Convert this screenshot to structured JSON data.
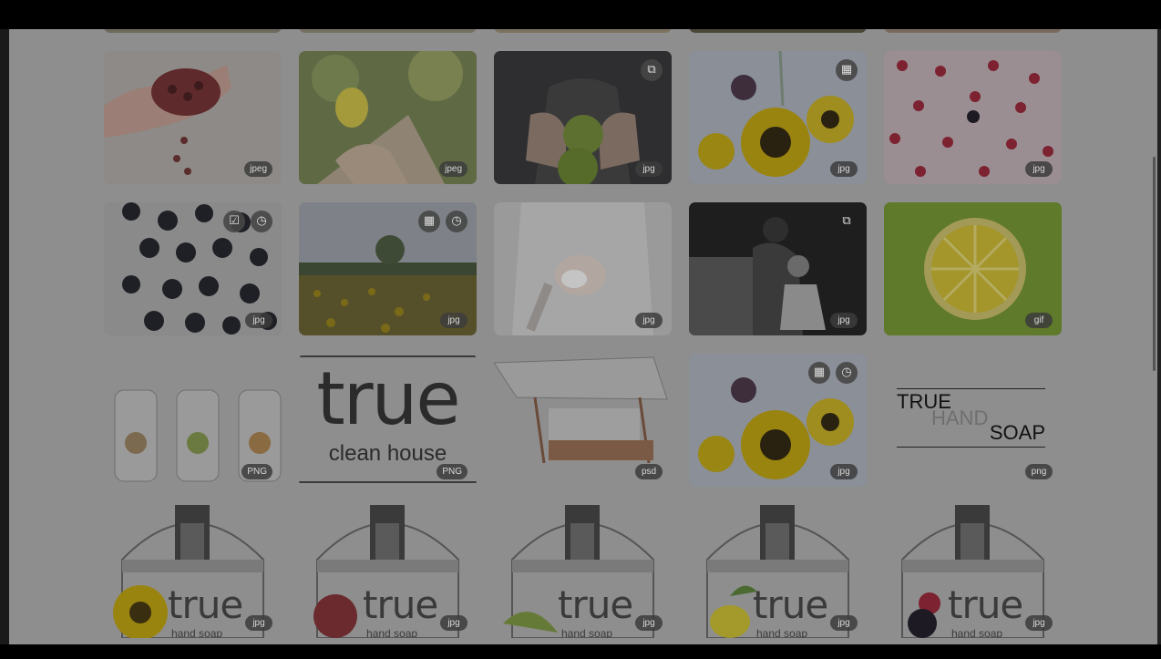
{
  "colors": {
    "overlay": "#8e8e8e",
    "frame": "#000000",
    "badge_bg": "#3c3c3c",
    "badge_text": "#d8d8d8"
  },
  "row0": [
    {
      "name": "partial-tile-1"
    },
    {
      "name": "partial-tile-2"
    },
    {
      "name": "partial-tile-3"
    },
    {
      "name": "partial-tile-4"
    },
    {
      "name": "partial-tile-5"
    }
  ],
  "rows": [
    [
      {
        "subject": "pomegranate-in-hand",
        "ext": "jpeg",
        "icons": []
      },
      {
        "subject": "lemon-on-tree",
        "ext": "jpeg",
        "icons": []
      },
      {
        "subject": "hands-holding-limes",
        "ext": "jpg",
        "icons": [
          "link-icon"
        ]
      },
      {
        "subject": "sunflower-bouquet",
        "ext": "jpg",
        "icons": [
          "calendar-icon"
        ]
      },
      {
        "subject": "raspberries-on-pink",
        "ext": "jpg",
        "icons": []
      }
    ],
    [
      {
        "subject": "blueberries",
        "ext": "jpg",
        "icons": [
          "checklist-icon",
          "schedule-icon"
        ]
      },
      {
        "subject": "sunflower-field",
        "ext": "jpg",
        "icons": [
          "calendar-icon",
          "schedule-icon"
        ]
      },
      {
        "subject": "hands-washing-soap",
        "ext": "jpg",
        "icons": []
      },
      {
        "subject": "mother-child-sink",
        "ext": "jpg",
        "icons": [
          "link-icon"
        ]
      },
      {
        "subject": "lemon-logo-green",
        "ext": "gif",
        "icons": []
      }
    ],
    [
      {
        "subject": "spray-bottles",
        "ext": "PNG",
        "icons": []
      },
      {
        "subject": "true-clean-house-logo",
        "ext": "PNG",
        "icons": []
      },
      {
        "subject": "market-stand-render",
        "ext": "psd",
        "icons": []
      },
      {
        "subject": "sunflower-bouquet-2",
        "ext": "jpg",
        "icons": [
          "calendar-icon",
          "schedule-icon"
        ]
      },
      {
        "subject": "true-hand-soap-wordmark",
        "ext": "png",
        "icons": []
      }
    ],
    [
      {
        "subject": "soap-bottle-sunflower",
        "ext": "jpg",
        "icons": []
      },
      {
        "subject": "soap-bottle-pomegranate",
        "ext": "jpg",
        "icons": []
      },
      {
        "subject": "soap-bottle-lime",
        "ext": "jpg",
        "icons": []
      },
      {
        "subject": "soap-bottle-lemon",
        "ext": "jpg",
        "icons": []
      },
      {
        "subject": "soap-bottle-berries",
        "ext": "jpg",
        "icons": []
      }
    ]
  ],
  "logo_clean_house": {
    "word": "true",
    "tagline": "clean house"
  },
  "logo_hand_soap": {
    "l1": "TRUE",
    "l2": "HAND",
    "l3": "SOAP"
  },
  "bottle_label": {
    "word": "true",
    "sub": "hand soap"
  }
}
